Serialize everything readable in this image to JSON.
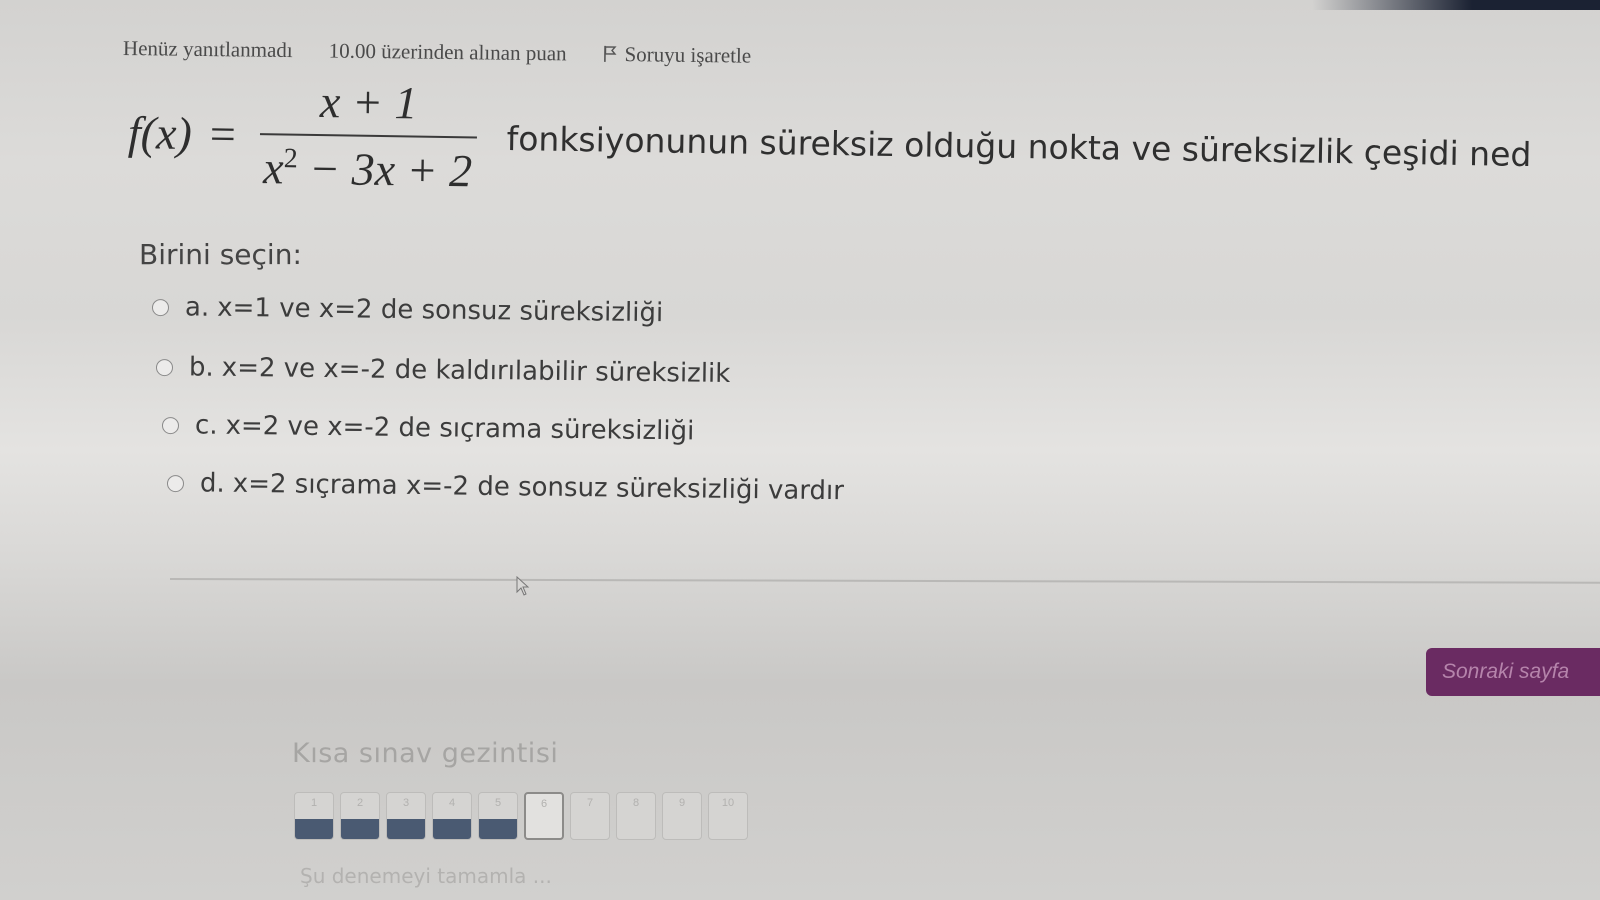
{
  "header": {
    "status": "Henüz yanıtlanmadı",
    "points": "10.00 üzerinden alınan puan",
    "flag_label": "Soruyu işaretle"
  },
  "question": {
    "lhs": "f(x)",
    "equals": "=",
    "numerator": "x + 1",
    "denominator_base": "x",
    "denominator_exp": "2",
    "denominator_rest": " − 3x + 2",
    "text": "fonksiyonunun süreksiz olduğu nokta ve süreksizlik çeşidi ned"
  },
  "choose_label": "Birini seçin:",
  "options": [
    {
      "letter": "a.",
      "text": "x=1 ve x=2 de sonsuz süreksizliği"
    },
    {
      "letter": "b.",
      "text": "x=2 ve x=-2 de kaldırılabilir süreksizlik"
    },
    {
      "letter": "c.",
      "text": "x=2 ve x=-2 de sıçrama süreksizliği"
    },
    {
      "letter": "d.",
      "text": "x=2 sıçrama x=-2 de sonsuz süreksizliği vardır"
    }
  ],
  "next_button": "Sonraki sayfa",
  "quiz_nav": {
    "title": "Kısa sınav gezintisi",
    "buttons": [
      {
        "label": "1",
        "answered": true
      },
      {
        "label": "2",
        "answered": true
      },
      {
        "label": "3",
        "answered": true
      },
      {
        "label": "4",
        "answered": true
      },
      {
        "label": "5",
        "answered": true
      },
      {
        "label": "6",
        "answered": false,
        "current": true
      },
      {
        "label": "7",
        "answered": false
      },
      {
        "label": "8",
        "answered": false
      },
      {
        "label": "9",
        "answered": false
      },
      {
        "label": "10",
        "answered": false
      }
    ],
    "footer": "Şu denemeyi tamamla ..."
  },
  "colors": {
    "next_button_bg": "#6a2b62",
    "answered_fill": "#4a5a72"
  }
}
